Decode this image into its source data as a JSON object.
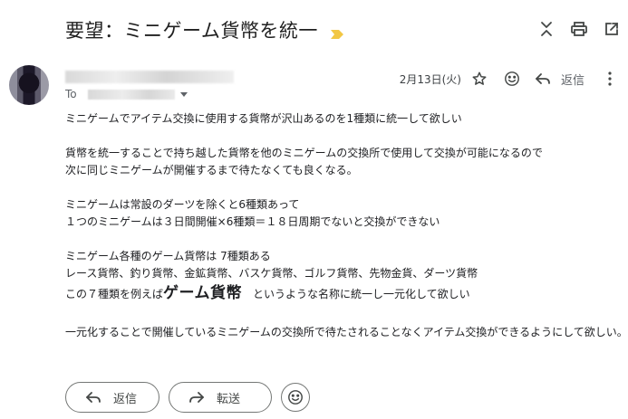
{
  "header": {
    "subject": "要望：ミニゲーム貨幣を統一"
  },
  "message": {
    "to_label": "To",
    "date": "2月13日(火)",
    "reply_label": "返信",
    "body": [
      "ミニゲームでアイテム交換に使用する貨幣が沢山あるのを1種類に統一して欲しい",
      "",
      "貨幣を統一することで持ち越した貨幣を他のミニゲームの交換所で使用して交換が可能になるので",
      "次に同じミニゲームが開催するまで待たなくても良くなる。",
      "",
      "ミニゲームは常設のダーツを除くと6種類あって",
      "１つのミニゲームは３日間開催×6種類＝１８日周期でないと交換ができない",
      "",
      "ミニゲーム各種のゲーム貨幣は 7種類ある",
      "レース貨幣、釣り貨幣、金鉱貨幣、バスケ貨幣、ゴルフ貨幣、先物金貨、ダーツ貨幣"
    ],
    "line11": {
      "before": "この７種類を例えば",
      "emphasis": "ゲーム貨幣",
      "after": "　というような名称に統一し一元化して欲しい"
    },
    "closing": "一元化することで開催しているミニゲームの交換所で待たされることなくアイテム交換ができるようにして欲しい。"
  },
  "footer": {
    "reply_label": "返信",
    "forward_label": "転送"
  },
  "icons": {
    "importance": "importance-marker-icon",
    "collapse": "collapse-all-icon",
    "print": "print-icon",
    "new_window": "open-in-new-window-icon",
    "star": "star-icon",
    "emoji": "emoji-reaction-icon",
    "reply": "reply-icon",
    "more": "more-vertical-icon",
    "forward": "forward-icon"
  },
  "colors": {
    "importance": "#f2c744",
    "text": "#202124",
    "icon": "#444746"
  }
}
